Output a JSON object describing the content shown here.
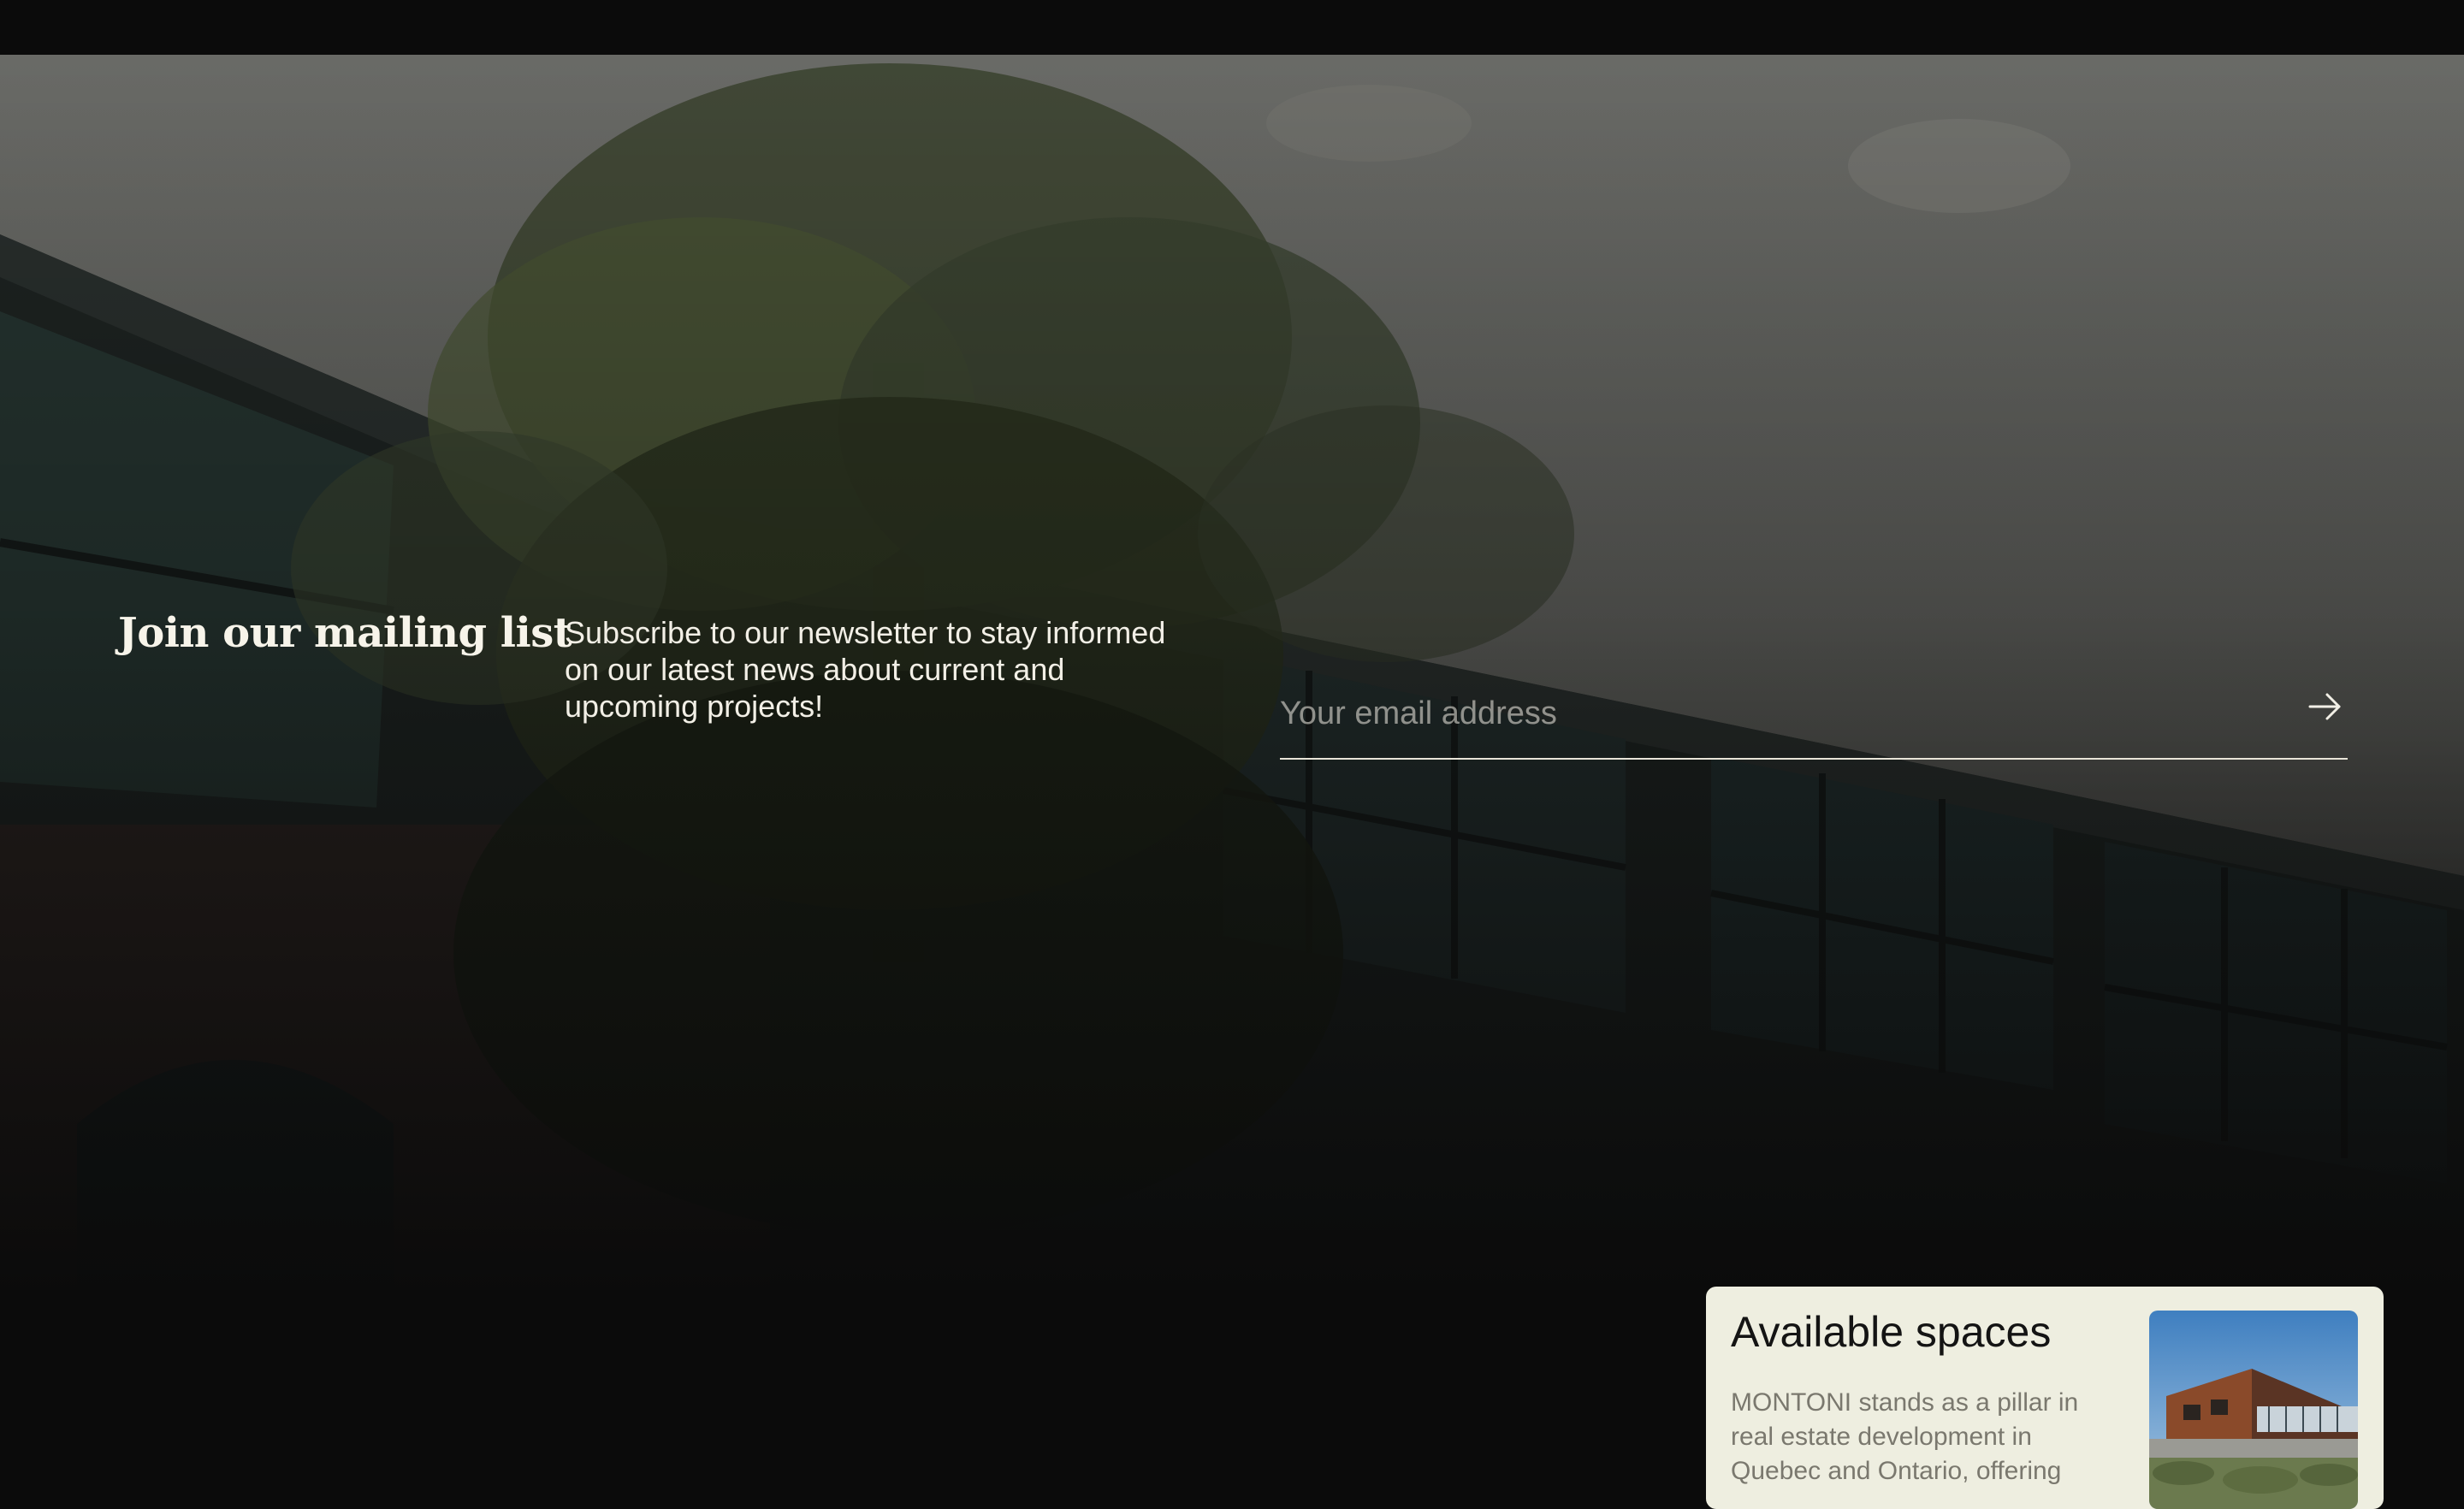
{
  "mailing_list": {
    "title": "Join our mailing list",
    "description": "Subscribe to our newsletter to stay informed on our latest news about current and upcoming projects!",
    "email_placeholder": "Your email address",
    "submit_icon": "arrow-right-icon"
  },
  "available_spaces": {
    "title": "Available spaces",
    "description": "MONTONI stands as a pillar in real estate development in Quebec and Ontario, offering"
  },
  "colors": {
    "page_background": "#0b0b0b",
    "text_light": "#f2efe6",
    "card_background": "#eeeee0",
    "card_title": "#141414",
    "card_text": "#7a786e"
  }
}
